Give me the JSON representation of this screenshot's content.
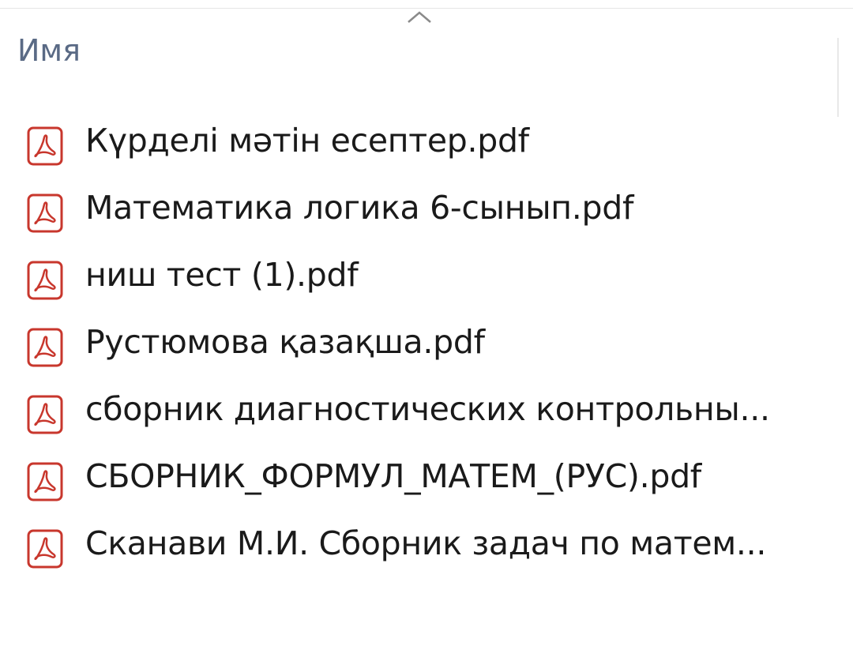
{
  "header": {
    "name_column_label": "Имя",
    "sort_direction": "ascending"
  },
  "files": [
    {
      "name": "Күрделі мәтін есептер.pdf",
      "icon": "pdf-file-icon"
    },
    {
      "name": "Математика логика 6-сынып.pdf",
      "icon": "pdf-file-icon"
    },
    {
      "name": "ниш тест (1).pdf",
      "icon": "pdf-file-icon"
    },
    {
      "name": "Рустюмова қазақша.pdf",
      "icon": "pdf-file-icon"
    },
    {
      "name": "сборник диагностических контрольны...",
      "icon": "pdf-file-icon"
    },
    {
      "name": "СБОРНИК_ФОРМУЛ_МАТЕМ_(РУС).pdf",
      "icon": "pdf-file-icon"
    },
    {
      "name": "Сканави М.И. Сборник задач по матем...",
      "icon": "pdf-file-icon"
    }
  ],
  "colors": {
    "pdf_icon_red": "#c8372d",
    "header_text": "#5a6a85",
    "file_text": "#1a1a1a"
  }
}
